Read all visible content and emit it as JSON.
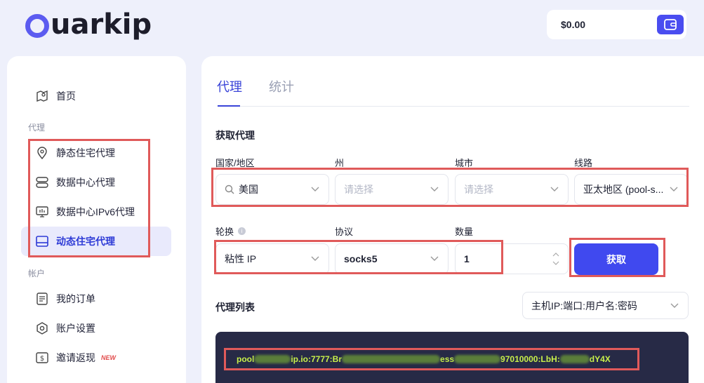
{
  "brand": {
    "logo_text": "uarkip"
  },
  "wallet": {
    "balance": "$0.00",
    "icon": "wallet-icon"
  },
  "sidebar": {
    "home": "首页",
    "section_proxy": "代理",
    "items": [
      {
        "label": "静态住宅代理",
        "icon": "location-pin-icon"
      },
      {
        "label": "数据中心代理",
        "icon": "server-icon"
      },
      {
        "label": "数据中心IPv6代理",
        "icon": "monitor-icon"
      },
      {
        "label": "动态住宅代理",
        "icon": "drive-icon",
        "active": true
      }
    ],
    "section_account": "帐户",
    "account_items": [
      {
        "label": "我的订单",
        "icon": "document-icon"
      },
      {
        "label": "账户设置",
        "icon": "gear-icon"
      },
      {
        "label": "邀请返现",
        "icon": "dollar-icon",
        "badge": "NEW"
      }
    ]
  },
  "main": {
    "tabs": [
      {
        "label": "代理",
        "active": true
      },
      {
        "label": "统计",
        "active": false
      }
    ],
    "get_proxy_title": "获取代理",
    "fields": {
      "country": {
        "label": "国家/地区",
        "value": "美国"
      },
      "state": {
        "label": "州",
        "placeholder": "请选择"
      },
      "city": {
        "label": "城市",
        "placeholder": "请选择"
      },
      "route": {
        "label": "线路",
        "value": "亚太地区 (pool-s..."
      },
      "rotation": {
        "label": "轮换",
        "value": "粘性 IP"
      },
      "protocol": {
        "label": "协议",
        "value": "socks5"
      },
      "quantity": {
        "label": "数量",
        "value": "1"
      }
    },
    "get_button": "获取",
    "proxy_list_title": "代理列表",
    "format_select": "主机IP:端口:用户名:密码",
    "proxy_segments": [
      "pool",
      "ip.io:7777:Br",
      "ess",
      "97010000:LbH:",
      "dY4X"
    ]
  },
  "colors": {
    "accent": "#4049ef",
    "highlight_box": "#e05a5a",
    "proxy_text": "#c8f04a"
  }
}
